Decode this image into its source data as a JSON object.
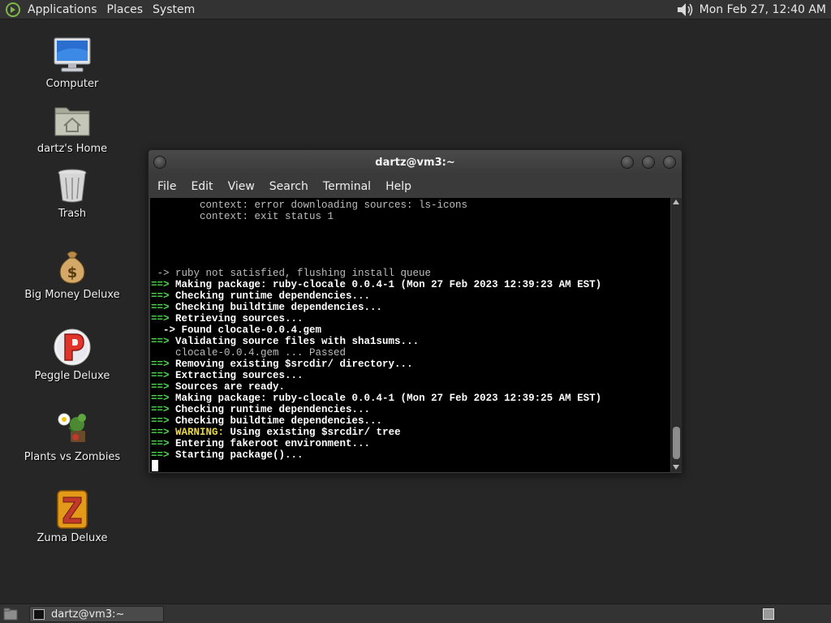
{
  "top_panel": {
    "menus": [
      "Applications",
      "Places",
      "System"
    ],
    "clock": "Mon Feb 27, 12:40 AM",
    "icons": {
      "logo": "distro-logo-icon",
      "volume": "volume-icon"
    }
  },
  "desktop_icons": [
    {
      "label": "Computer",
      "icon": "computer-icon"
    },
    {
      "label": "dartz's Home",
      "icon": "home-folder-icon"
    },
    {
      "label": "Trash",
      "icon": "trash-icon"
    },
    {
      "label": "Big Money Deluxe",
      "icon": "money-bag-icon"
    },
    {
      "label": "Peggle Deluxe",
      "icon": "peggle-icon"
    },
    {
      "label": "Plants vs Zombies",
      "icon": "plants-vs-zombies-icon"
    },
    {
      "label": "Zuma Deluxe",
      "icon": "zuma-icon"
    }
  ],
  "terminal": {
    "title": "dartz@vm3:~",
    "menu": [
      "File",
      "Edit",
      "View",
      "Search",
      "Terminal",
      "Help"
    ],
    "lines": [
      {
        "prefix": "",
        "text": "        context: error downloading sources: ls-icons",
        "style": "dim"
      },
      {
        "prefix": "",
        "text": "        context: exit status 1",
        "style": "dim"
      },
      {
        "prefix": "",
        "text": "",
        "style": "dim"
      },
      {
        "prefix": "",
        "text": "",
        "style": "dim"
      },
      {
        "prefix": "",
        "text": "",
        "style": "dim"
      },
      {
        "prefix": "",
        "text": "",
        "style": "dim"
      },
      {
        "prefix": "",
        "text": " -> ruby not satisfied, flushing install queue",
        "style": "dim"
      },
      {
        "prefix": "==>",
        "text": " Making package: ruby-clocale 0.0.4-1 (Mon 27 Feb 2023 12:39:23 AM EST)",
        "style": "bold"
      },
      {
        "prefix": "==>",
        "text": " Checking runtime dependencies...",
        "style": "bold"
      },
      {
        "prefix": "==>",
        "text": " Checking buildtime dependencies...",
        "style": "bold"
      },
      {
        "prefix": "==>",
        "text": " Retrieving sources...",
        "style": "bold"
      },
      {
        "prefix": "",
        "text": "  -> Found clocale-0.0.4.gem",
        "style": "bold"
      },
      {
        "prefix": "==>",
        "text": " Validating source files with sha1sums...",
        "style": "bold"
      },
      {
        "prefix": "",
        "text": "    clocale-0.0.4.gem ... Passed",
        "style": "dim"
      },
      {
        "prefix": "==>",
        "text": " Removing existing $srcdir/ directory...",
        "style": "bold"
      },
      {
        "prefix": "==>",
        "text": " Extracting sources...",
        "style": "bold"
      },
      {
        "prefix": "==>",
        "text": " Sources are ready.",
        "style": "bold"
      },
      {
        "prefix": "==>",
        "text": " Making package: ruby-clocale 0.0.4-1 (Mon 27 Feb 2023 12:39:25 AM EST)",
        "style": "bold"
      },
      {
        "prefix": "==>",
        "text": " Checking runtime dependencies...",
        "style": "bold"
      },
      {
        "prefix": "==>",
        "text": " Checking buildtime dependencies...",
        "style": "bold"
      },
      {
        "prefix": "==>",
        "warn": " WARNING:",
        "text": " Using existing $srcdir/ tree",
        "style": "bold"
      },
      {
        "prefix": "==>",
        "text": " Entering fakeroot environment...",
        "style": "bold"
      },
      {
        "prefix": "==>",
        "text": " Starting package()...",
        "style": "bold"
      }
    ]
  },
  "bottom_panel": {
    "task_label": "dartz@vm3:~",
    "icons": {
      "show_desktop": "show-desktop-icon",
      "task": "terminal-icon",
      "workspace": "workspace-switcher-icon"
    }
  }
}
